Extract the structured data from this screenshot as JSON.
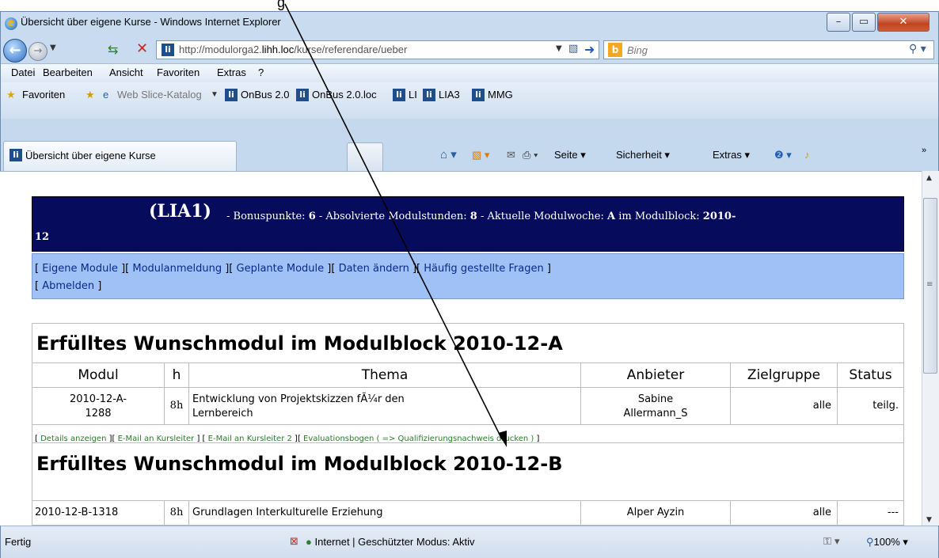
{
  "annotation": {
    "caption": "g"
  },
  "window": {
    "title": "Übersicht über eigene Kurse - Windows Internet Explorer",
    "controls": {
      "min": "–",
      "max": "▭",
      "close": "✕"
    }
  },
  "address_bar": {
    "url_prefix": "http://modulorga2.",
    "url_host": "lihh.loc",
    "url_suffix": "/kurse/referendare/ueber",
    "search_placeholder": "Bing"
  },
  "menu": [
    "Datei",
    "Bearbeiten",
    "Ansicht",
    "Favoriten",
    "Extras",
    "?"
  ],
  "favorites_bar": {
    "favorites_label": "Favoriten",
    "web_slice": "Web Slice-Katalog",
    "links": [
      "OnBus 2.0",
      "OnBus 2.0.loc",
      "LI",
      "LIA3",
      "MMG"
    ]
  },
  "tab": {
    "label": "Übersicht über eigene Kurse"
  },
  "command_bar": {
    "page": "Seite",
    "security": "Sicherheit",
    "tools": "Extras",
    "more": "»"
  },
  "status_bar": {
    "status": "Fertig",
    "zone": "Internet | Geschützter Modus: Aktiv",
    "zoom": "100%"
  },
  "page": {
    "header": {
      "user": "(LIA1)",
      "info_prefix": " - Bonuspunkte: ",
      "bonus": "6",
      "info_mid1": " - Absolvierte Modulstunden: ",
      "hours": "8",
      "info_mid2": " - Aktuelle Modulwoche: ",
      "week": "A",
      "info_mid3": " im Modulblock: ",
      "block_start": "2010-",
      "block_end": "12"
    },
    "nav": [
      "Eigene Module",
      "Modulanmeldung",
      "Geplante Module",
      "Daten ändern",
      "Häufig gestellte Fragen",
      "Abmelden"
    ],
    "section_a": {
      "heading": "Erfülltes Wunschmodul im Modulblock 2010-12-A",
      "columns": [
        "Modul",
        "h",
        "Thema",
        "Anbieter",
        "Zielgruppe",
        "Status"
      ],
      "row": {
        "modul_line1": "2010-12-A-",
        "modul_line2": "1288",
        "h": "8h",
        "thema_line1": "Entwicklung von Projektskizzen fÃ¼r den",
        "thema_line2": "Lernbereich",
        "anbieter_line1": "Sabine",
        "anbieter_line2": "Allermann_S",
        "zielgruppe": "alle",
        "status": "teilg."
      },
      "links": [
        "Details anzeigen",
        "E-Mail an Kursleiter",
        "E-Mail an Kursleiter 2",
        "Evaluationsbogen ( => Qualifizierungsnachweis drucken )"
      ]
    },
    "section_b": {
      "heading": "Erfülltes Wunschmodul im Modulblock 2010-12-B",
      "row": {
        "modul": "2010-12-B-1318",
        "h": "8h",
        "thema": "Grundlagen Interkulturelle Erziehung",
        "anbieter": "Alper Ayzin",
        "zielgruppe": "alle",
        "status": "---"
      }
    }
  }
}
